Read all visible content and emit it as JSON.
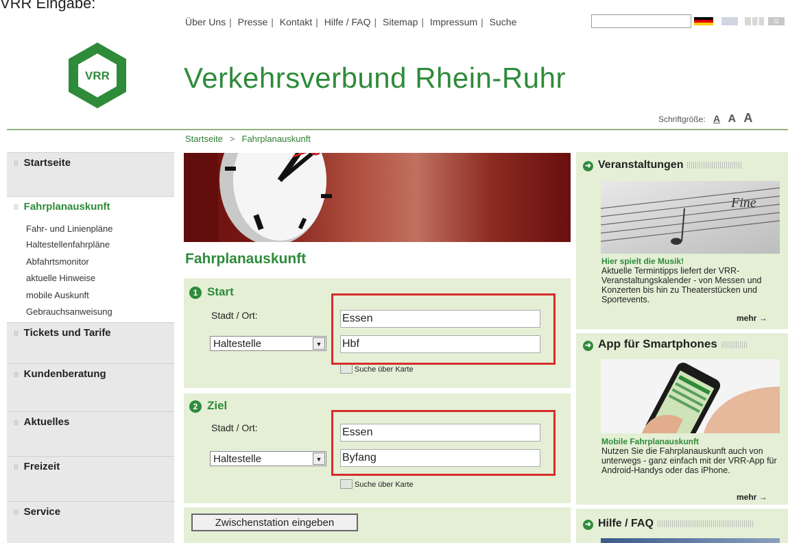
{
  "caption": "VRR Eingabe:",
  "top_links": [
    "Über Uns",
    "Presse",
    "Kontakt",
    "Hilfe / FAQ",
    "Sitemap",
    "Impressum",
    "Suche"
  ],
  "search": {
    "value": "",
    "placeholder": ""
  },
  "logo_text": "VRR",
  "site_title": "Verkehrsverbund Rhein-Ruhr",
  "font_size": {
    "label": "Schriftgröße:",
    "a": "A"
  },
  "breadcrumb": [
    "Startseite",
    ">",
    "Fahrplanauskunft"
  ],
  "sidebar": {
    "sections": [
      "Startseite",
      "Fahrplanauskunft",
      "Tickets und Tarife",
      "Kundenberatung",
      "Aktuelles",
      "Freizeit",
      "Service"
    ],
    "sub_items": [
      "Fahr- und Linienpläne",
      "Haltestellenfahrpläne",
      "Abfahrtsmonitor",
      "aktuelle Hinweise",
      "mobile Auskunft",
      "Gebrauchsanweisung"
    ]
  },
  "main": {
    "title": "Fahrplanauskunft",
    "start": {
      "number": "1",
      "title": "Start",
      "city_label": "Stadt / Ort:",
      "city_value": "Essen",
      "type_select": "Haltestelle",
      "stop_value": "Hbf",
      "map_link": "Suche über Karte"
    },
    "ziel": {
      "number": "2",
      "title": "Ziel",
      "city_label": "Stadt / Ort:",
      "city_value": "Essen",
      "type_select": "Haltestelle",
      "stop_value": "Byfang",
      "map_link": "Suche über Karte"
    },
    "zwischen_button": "Zwischenstation eingeben"
  },
  "right": {
    "events": {
      "title": "Veranstaltungen",
      "image_text": "Fine",
      "subtitle": "Hier spielt die Musik!",
      "text": "Aktuelle Termintipps liefert der VRR-Veranstaltungskalender - von Messen und Konzerten bis hin zu Theaterstücken und Sportevents.",
      "more": "mehr →"
    },
    "app": {
      "title": "App für Smartphones",
      "subtitle": "Mobile Fahrplanauskunft",
      "text": "Nutzen Sie die Fahrplanauskunft auch von unterwegs - ganz einfach mit der VRR-App für Android-Handys oder das iPhone.",
      "more": "mehr →"
    },
    "help": {
      "title": "Hilfe / FAQ"
    }
  },
  "colors": {
    "brand_green": "#2e8b3a",
    "panel_bg": "#e4efd6",
    "highlight_red": "#d62b2b",
    "sidebar_bg": "#e8e8e8"
  },
  "icons": {
    "go": "arrow-circle-icon",
    "map": "map-icon",
    "select_arrow": "chevron-down-icon"
  }
}
